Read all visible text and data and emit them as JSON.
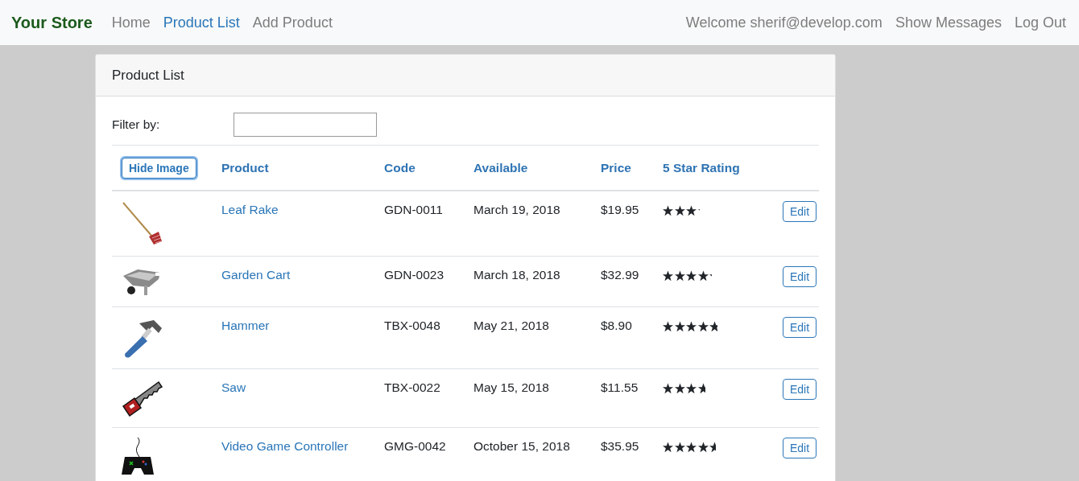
{
  "navbar": {
    "brand": "Your Store",
    "links": [
      {
        "label": "Home",
        "selected": false
      },
      {
        "label": "Product List",
        "selected": true
      },
      {
        "label": "Add Product",
        "selected": false
      }
    ],
    "welcome": "Welcome sherif@develop.com",
    "actions": [
      "Show Messages",
      "Log Out"
    ]
  },
  "card": {
    "title": "Product List",
    "filter": {
      "label": "Filter by:"
    },
    "table": {
      "toggle_button": "Hide Image",
      "columns": [
        "Product",
        "Code",
        "Available",
        "Price",
        "5 Star Rating"
      ],
      "rows": [
        {
          "product": "Leaf Rake",
          "code": "GDN-0011",
          "available": "March 19, 2018",
          "price": "$19.95",
          "stars": 3.2,
          "action": "Edit"
        },
        {
          "product": "Garden Cart",
          "code": "GDN-0023",
          "available": "March 18, 2018",
          "price": "$32.99",
          "stars": 4.2,
          "action": "Edit"
        },
        {
          "product": "Hammer",
          "code": "TBX-0048",
          "available": "May 21, 2018",
          "price": "$8.90",
          "stars": 4.8,
          "action": "Edit"
        },
        {
          "product": "Saw",
          "code": "TBX-0022",
          "available": "May 15, 2018",
          "price": "$11.55",
          "stars": 3.7,
          "action": "Edit"
        },
        {
          "product": "Video Game Controller",
          "code": "GMG-0042",
          "available": "October 15, 2018",
          "price": "$35.95",
          "stars": 4.6,
          "action": "Edit"
        }
      ]
    }
  }
}
